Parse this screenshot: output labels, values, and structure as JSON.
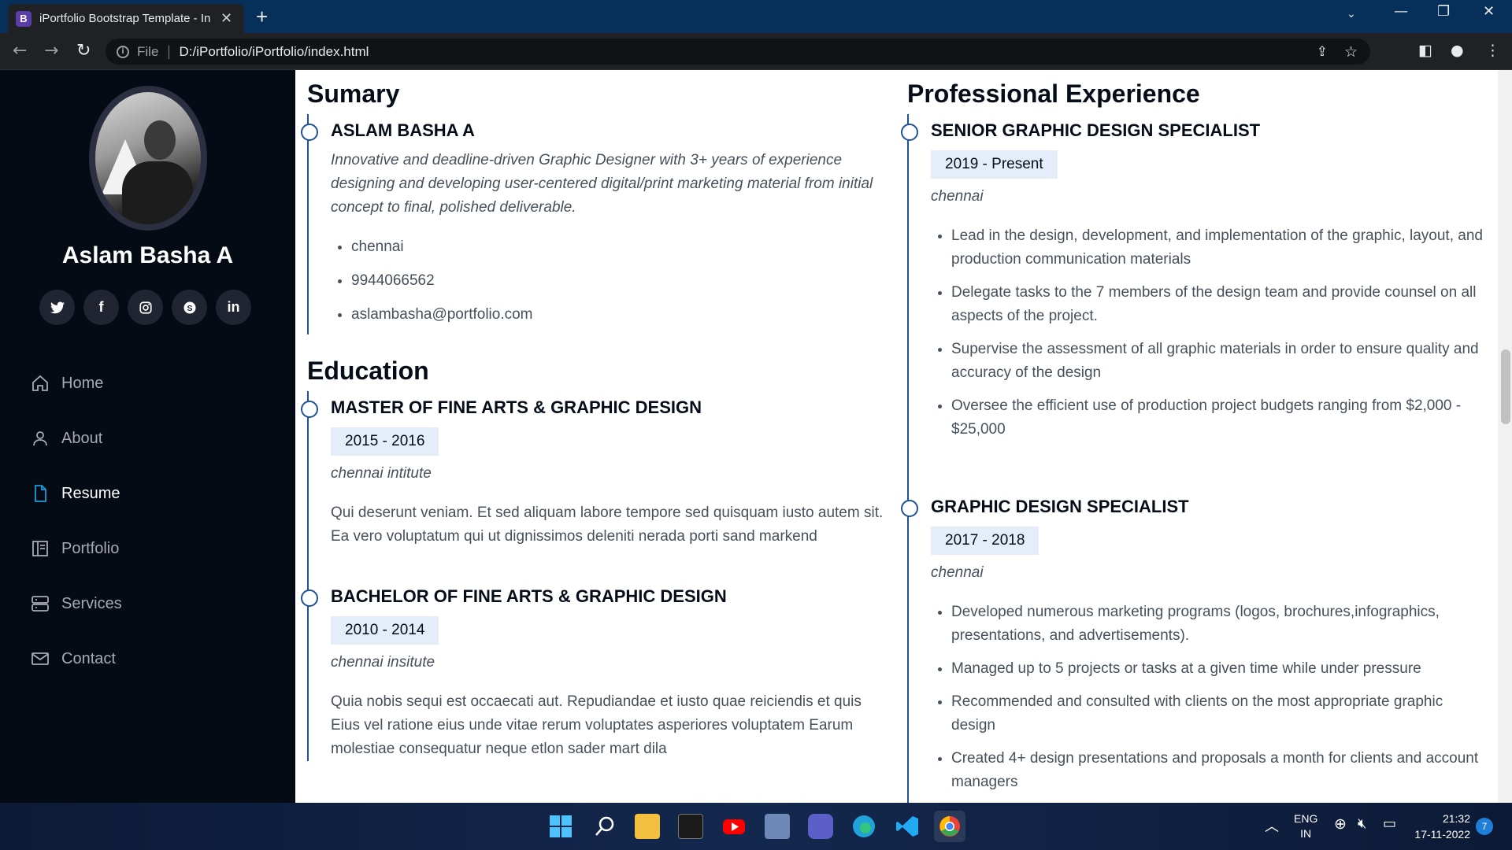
{
  "browser": {
    "tab_title": "iPortfolio Bootstrap Template - In",
    "tab_favicon": "B",
    "url_scheme": "File",
    "url": "D:/iPortfolio/iPortfolio/index.html"
  },
  "sidebar": {
    "name": "Aslam Basha A",
    "socials": [
      "twitter-icon",
      "facebook-icon",
      "instagram-icon",
      "skype-icon",
      "linkedin-icon"
    ],
    "nav": [
      {
        "label": "Home",
        "icon": "home-icon",
        "active": false
      },
      {
        "label": "About",
        "icon": "person-icon",
        "active": false
      },
      {
        "label": "Resume",
        "icon": "file-icon",
        "active": true
      },
      {
        "label": "Portfolio",
        "icon": "book-icon",
        "active": false
      },
      {
        "label": "Services",
        "icon": "server-icon",
        "active": false
      },
      {
        "label": "Contact",
        "icon": "envelope-icon",
        "active": false
      }
    ],
    "accent": "#149ddd"
  },
  "resume": {
    "summary_title": "Sumary",
    "summary": {
      "name": "ASLAM BASHA A",
      "description": "Innovative and deadline-driven Graphic Designer with 3+ years of experience designing and developing user-centered digital/print marketing material from initial concept to final, polished deliverable.",
      "details": [
        "chennai",
        "9944066562",
        "aslambasha@portfolio.com"
      ]
    },
    "education_title": "Education",
    "education": [
      {
        "title": "MASTER OF FINE ARTS & GRAPHIC DESIGN",
        "years": "2015 - 2016",
        "place": "chennai intitute",
        "text": "Qui deserunt veniam. Et sed aliquam labore tempore sed quisquam iusto autem sit. Ea vero voluptatum qui ut dignissimos deleniti nerada porti sand markend"
      },
      {
        "title": "BACHELOR OF FINE ARTS & GRAPHIC DESIGN",
        "years": "2010 - 2014",
        "place": "chennai insitute",
        "text": "Quia nobis sequi est occaecati aut. Repudiandae et iusto quae reiciendis et quis Eius vel ratione eius unde vitae rerum voluptates asperiores voluptatem Earum molestiae consequatur neque etlon sader mart dila"
      }
    ],
    "experience_title": "Professional Experience",
    "experience": [
      {
        "title": "SENIOR GRAPHIC DESIGN SPECIALIST",
        "years": "2019 - Present",
        "place": "chennai",
        "bullets": [
          "Lead in the design, development, and implementation of the graphic, layout, and production communication materials",
          "Delegate tasks to the 7 members of the design team and provide counsel on all aspects of the project.",
          "Supervise the assessment of all graphic materials in order to ensure quality and accuracy of the design",
          "Oversee the efficient use of production project budgets ranging from $2,000 - $25,000"
        ]
      },
      {
        "title": "GRAPHIC DESIGN SPECIALIST",
        "years": "2017 - 2018",
        "place": "chennai",
        "bullets": [
          "Developed numerous marketing programs (logos, brochures,infographics, presentations, and advertisements).",
          "Managed up to 5 projects or tasks at a given time while under pressure",
          "Recommended and consulted with clients on the most appropriate graphic design",
          "Created 4+ design presentations and proposals a month for clients and account managers"
        ]
      }
    ]
  },
  "taskbar": {
    "lang": "ENG",
    "region": "IN",
    "time": "21:32",
    "date": "17-11-2022",
    "notifications": "7"
  }
}
